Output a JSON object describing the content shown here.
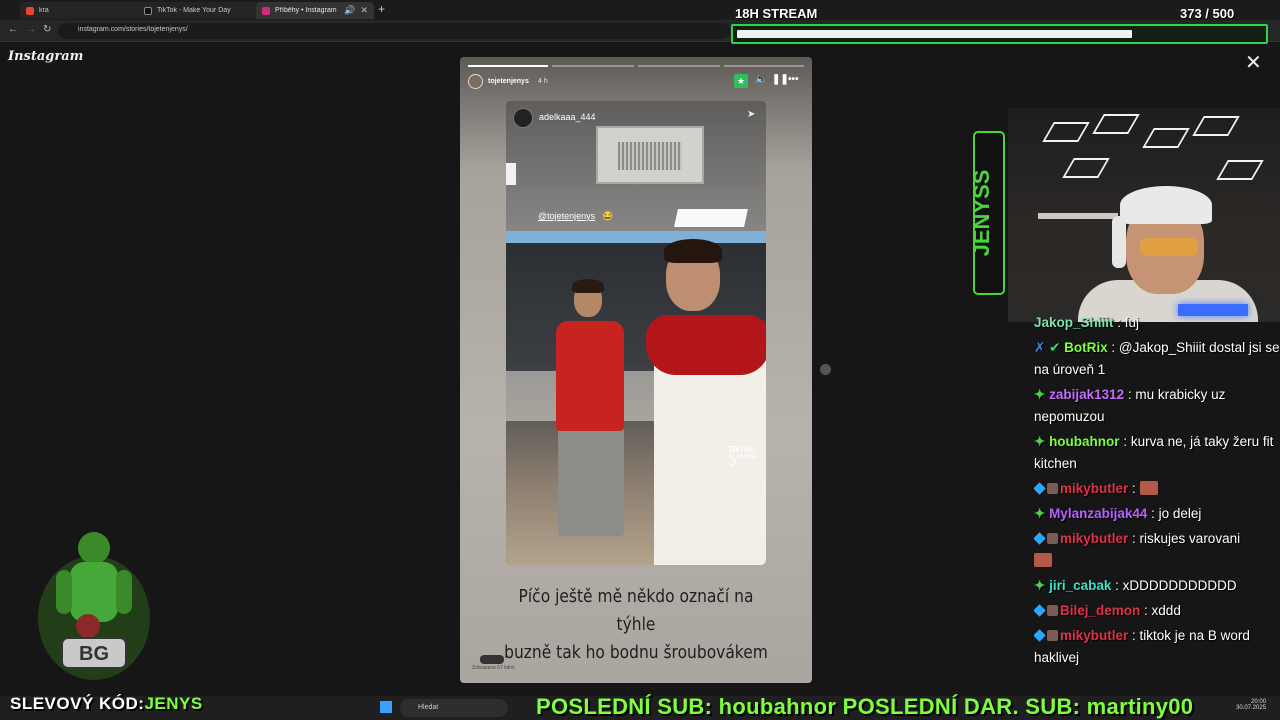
{
  "browser": {
    "tabs": [
      {
        "label": "kra",
        "active": false,
        "color": "#e8452c"
      },
      {
        "label": "TikTok - Make Your Day",
        "active": false,
        "color": "#111111"
      },
      {
        "label": "Příběhy • Instagram",
        "active": true,
        "color": "#d6287d"
      }
    ],
    "url": "instagram.com/stories/tojetenjenys/"
  },
  "stream": {
    "title": "18H STREAM",
    "count": "373  / 500",
    "progress": 0.746
  },
  "instagram": {
    "logo": "Instagram",
    "story_user": "tojetenjenys",
    "story_time": "4 h",
    "inner_user": "adelkaaa_444",
    "mention": "@tojetenjenys",
    "tiktok_label": "TikTok",
    "tiktok_handle": "@ axytime",
    "caption_line1": "Píčo ještě mě někdo označí na týhle",
    "caption_line2": "buzně tak ho bodnu šroubovákem",
    "seen_label": "Zobrazeno 67 lidmi"
  },
  "chat": [
    {
      "user": "Jakop_Shiiit",
      "text": "fuj",
      "color": "#7fe0b0",
      "badges": []
    },
    {
      "user": "BotRix",
      "text": "@Jakop_Shiiit dostal jsi se na úroveň 1",
      "color": "#7dff3e",
      "badges": [
        "sword",
        "check"
      ]
    },
    {
      "user": "zabijak1312",
      "text": "mu krabicky uz nepomuzou",
      "color": "#c86cff",
      "badges": [
        "gem"
      ]
    },
    {
      "user": "houbahnor",
      "text": "kurva ne, já taky žeru fit kitchen",
      "color": "#7dff3e",
      "badges": [
        "gem"
      ]
    },
    {
      "user": "mikybutler",
      "text": "",
      "color": "#e0304a",
      "badges": [
        "diamond",
        "av"
      ],
      "emote": true
    },
    {
      "user": "Mylanzabijak44",
      "text": "jo delej",
      "color": "#b561ff",
      "badges": [
        "gem"
      ]
    },
    {
      "user": "mikybutler",
      "text": "riskujes varovani",
      "color": "#e0304a",
      "badges": [
        "diamond",
        "av"
      ],
      "emote_after": true
    },
    {
      "user": "jiri_cabak",
      "text": "xDDDDDDDDDDD",
      "color": "#3ce0c8",
      "badges": [
        "gem"
      ]
    },
    {
      "user": "Bilej_demon",
      "text": "xddd",
      "color": "#e0304a",
      "badges": [
        "diamond",
        "av"
      ]
    },
    {
      "user": "mikybutler",
      "text": "tiktok je na B word haklivej",
      "color": "#e0304a",
      "badges": [
        "diamond",
        "av"
      ]
    }
  ],
  "promo": {
    "label": "SLEVOVÝ KÓD:",
    "code": "JENYS"
  },
  "ticker": "POSLEDNÍ SUB: houbahnor  POSLEDNÍ DAR. SUB: martiny00",
  "taskbar": {
    "search": "Hledat",
    "time": "20:00",
    "date": "30.07.2025"
  },
  "colors": {
    "accent": "#2ed44a",
    "ticker": "#7dff3e"
  }
}
